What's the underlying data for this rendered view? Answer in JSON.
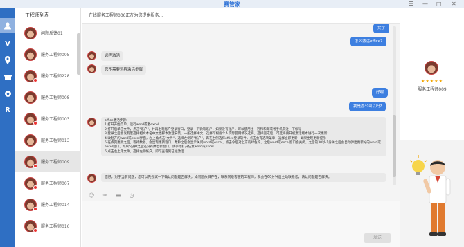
{
  "window": {
    "title": "赛管家",
    "controls": [
      "☰",
      "—",
      "□",
      "✕"
    ]
  },
  "leftbar": {
    "items": [
      {
        "icon": "user-icon"
      },
      {
        "icon": "v-logo-icon"
      },
      {
        "icon": "location-icon"
      },
      {
        "icon": "gift-icon"
      },
      {
        "icon": "settings-icon"
      },
      {
        "icon": "r-logo-icon"
      }
    ]
  },
  "contacts": {
    "header": "工程师列表",
    "items": [
      {
        "name": "问题反馈01"
      },
      {
        "name": "服务工程师005"
      },
      {
        "name": "服务工程师228"
      },
      {
        "name": "服务工程师008"
      },
      {
        "name": "服务工程师003"
      },
      {
        "name": "服务工程师013"
      },
      {
        "name": "服务工程师009"
      },
      {
        "name": "服务工程师007"
      },
      {
        "name": "服务工程师014"
      },
      {
        "name": "服务工程师016"
      }
    ]
  },
  "chat": {
    "header": "在线服务工程师006正在为您提供服务...",
    "messages": {
      "r1": "文字",
      "r2": "怎么激活office?",
      "l1": "远程激活",
      "l2": "您不需要远程激活步骤",
      "r3": "好啊",
      "r4": "我是办公可以吗?",
      "l3_lines": [
        "office激活步骤:",
        "1.打开开始菜单，运行word或者excel",
        "2.打开后单击文件，点击\"账户\"，并再出现账户登录窗口，登录一下微软账户，如果没有账户，可以使用注一行和和邮或者手机来注一下帐号",
        "3.登录之后会发有若选择相文本名中文档脚本激活安装，一般选择中文，选择可根据个人实际使用情况选择，选择完成后，可选择要开机激活版本进行一次更新",
        "4.收起开的word或excel界面，左上角点击\"文件\"，选择左侧的\"帐户\"，再在右侧选择office登录软件，点击会有选项菜单，选择立即更新，如果出现更新提示",
        "5.在点完更新之后，等待数秒，会出现更新窗口，数秒之后会显示关闭word或excel，点击今后对上方的绿色钩，之后word或excel窗口会关闭，之后的30秒-1分钟之后会自动弹出更新好的word或excel窗口，如果5分钟之后还没有弹出新窗口，请手动打开任意word或excel",
        "6.点击左上角文件，选择左侧帐户，即可查看到已经激活"
      ],
      "l4": "您好，对于当前问题，您可以先尝试一下确认问题是否解决，如问题依旧存在，联系同级客服的工程师，我会在60分钟后主动联系您，请认问题是否解决。"
    },
    "toolbar": {
      "icons": [
        "emoji-icon",
        "scissors-icon",
        "folder-icon",
        "history-icon"
      ]
    },
    "send_label": "发送"
  },
  "profile": {
    "stars": "★★★★★",
    "name": "服务工程师009"
  }
}
